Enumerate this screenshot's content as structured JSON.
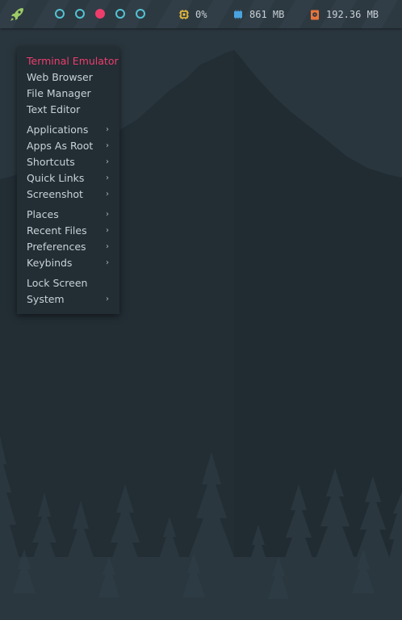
{
  "colors": {
    "accent": "#ee3d6c",
    "workspace_ring": "#52c3d4",
    "cpu_icon": "#f0c33c",
    "mem_icon": "#4aa3e0",
    "disk_icon": "#e8743b"
  },
  "topbar": {
    "launcher_icon": "rocket-icon",
    "workspaces": [
      {
        "state": "empty"
      },
      {
        "state": "empty"
      },
      {
        "state": "active"
      },
      {
        "state": "empty"
      },
      {
        "state": "empty"
      }
    ],
    "cpu": {
      "icon": "cpu-icon",
      "value": "0%"
    },
    "memory": {
      "icon": "memory-icon",
      "value": "861 MB"
    },
    "disk": {
      "icon": "disk-icon",
      "value": "192.36 MB"
    }
  },
  "menu": {
    "groups": [
      [
        {
          "label": "Terminal Emulator",
          "submenu": false,
          "highlighted": true
        },
        {
          "label": "Web Browser",
          "submenu": false
        },
        {
          "label": "File Manager",
          "submenu": false
        },
        {
          "label": "Text Editor",
          "submenu": false
        }
      ],
      [
        {
          "label": "Applications",
          "submenu": true
        },
        {
          "label": "Apps As Root",
          "submenu": true
        },
        {
          "label": "Shortcuts",
          "submenu": true
        },
        {
          "label": "Quick Links",
          "submenu": true
        },
        {
          "label": "Screenshot",
          "submenu": true
        }
      ],
      [
        {
          "label": "Places",
          "submenu": true
        },
        {
          "label": "Recent Files",
          "submenu": true
        },
        {
          "label": "Preferences",
          "submenu": true
        },
        {
          "label": "Keybinds",
          "submenu": true
        }
      ],
      [
        {
          "label": "Lock Screen",
          "submenu": false
        },
        {
          "label": "System",
          "submenu": true
        }
      ]
    ],
    "submenu_arrow": "›"
  }
}
